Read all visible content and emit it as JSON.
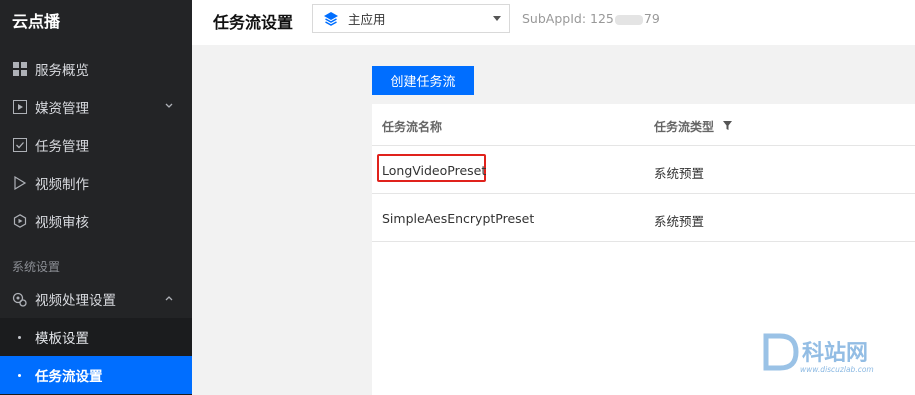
{
  "sidebar": {
    "brand": "云点播",
    "items": [
      {
        "label": "服务概览",
        "icon": "grid-icon"
      },
      {
        "label": "媒资管理",
        "icon": "play-box-icon",
        "expanded": false
      },
      {
        "label": "任务管理",
        "icon": "check-box-icon"
      },
      {
        "label": "视频制作",
        "icon": "play-triangle-icon"
      },
      {
        "label": "视频审核",
        "icon": "review-icon"
      }
    ],
    "section_label": "系统设置",
    "settings_group": {
      "label": "视频处理设置",
      "icon": "settings-cluster-icon",
      "expanded": true
    },
    "sub_items": [
      {
        "label": "模板设置",
        "active": false
      },
      {
        "label": "任务流设置",
        "active": true
      }
    ]
  },
  "header": {
    "title": "任务流设置",
    "app_select": {
      "value": "主应用",
      "icon": "layers-icon"
    },
    "subappid_prefix": "SubAppId: 125",
    "subappid_suffix": "79"
  },
  "main": {
    "create_button": "创建任务流",
    "table": {
      "columns": [
        "任务流名称",
        "任务流类型"
      ],
      "rows": [
        {
          "name": "LongVideoPreset",
          "type": "系统预置",
          "highlighted": true
        },
        {
          "name": "SimpleAesEncryptPreset",
          "type": "系统预置",
          "highlighted": false
        }
      ]
    }
  },
  "watermark": {
    "text": "科站网",
    "url_text": "www.discuzlab.com"
  },
  "colors": {
    "accent": "#006eff",
    "sidebar_bg": "#232426",
    "highlight": "#e0221c"
  }
}
